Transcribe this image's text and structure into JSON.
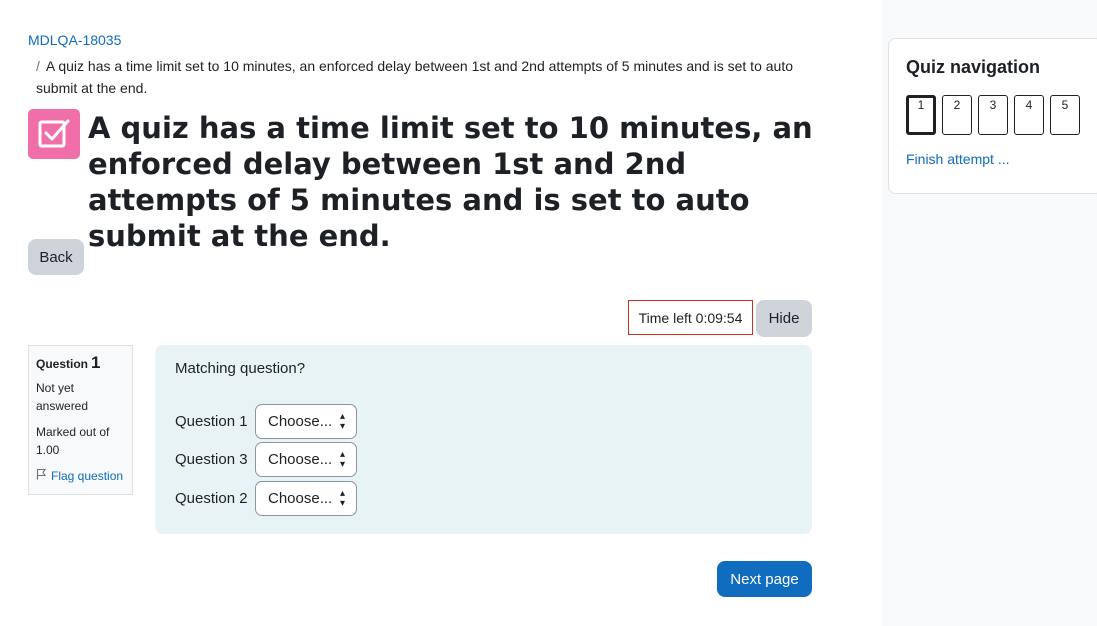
{
  "breadcrumb": {
    "course": "MDLQA-18035",
    "separator": "/",
    "activity": "A quiz has a time limit set to 10 minutes, an enforced delay between 1st and 2nd attempts of 5 minutes and is set to auto submit at the end."
  },
  "page": {
    "icon": "quiz-checkbox-icon",
    "icon_color": "#f06fa9",
    "title": "A quiz has a time limit set to 10 minutes, an enforced delay between 1st and 2nd attempts of 5 minutes and is set to auto submit at the end."
  },
  "buttons": {
    "back": "Back",
    "hide": "Hide",
    "next_page": "Next page"
  },
  "timer": {
    "text": "Time left 0:09:54"
  },
  "question_info": {
    "label": "Question",
    "number": "1",
    "state": "Not yet answered",
    "grade": "Marked out of 1.00",
    "flag": "Flag question"
  },
  "question": {
    "text": "Matching question?",
    "rows": [
      {
        "label": "Question 1",
        "selected": "Choose..."
      },
      {
        "label": "Question 3",
        "selected": "Choose..."
      },
      {
        "label": "Question 2",
        "selected": "Choose..."
      }
    ]
  },
  "quiz_navigation": {
    "title": "Quiz navigation",
    "buttons": [
      "1",
      "2",
      "3",
      "4",
      "5"
    ],
    "current": "1",
    "finish": "Finish attempt ..."
  },
  "colors": {
    "primary": "#0f6cbf",
    "timer_border": "#ca3120",
    "question_bg": "#e7f3f5",
    "secondary_button": "#ced4da"
  }
}
